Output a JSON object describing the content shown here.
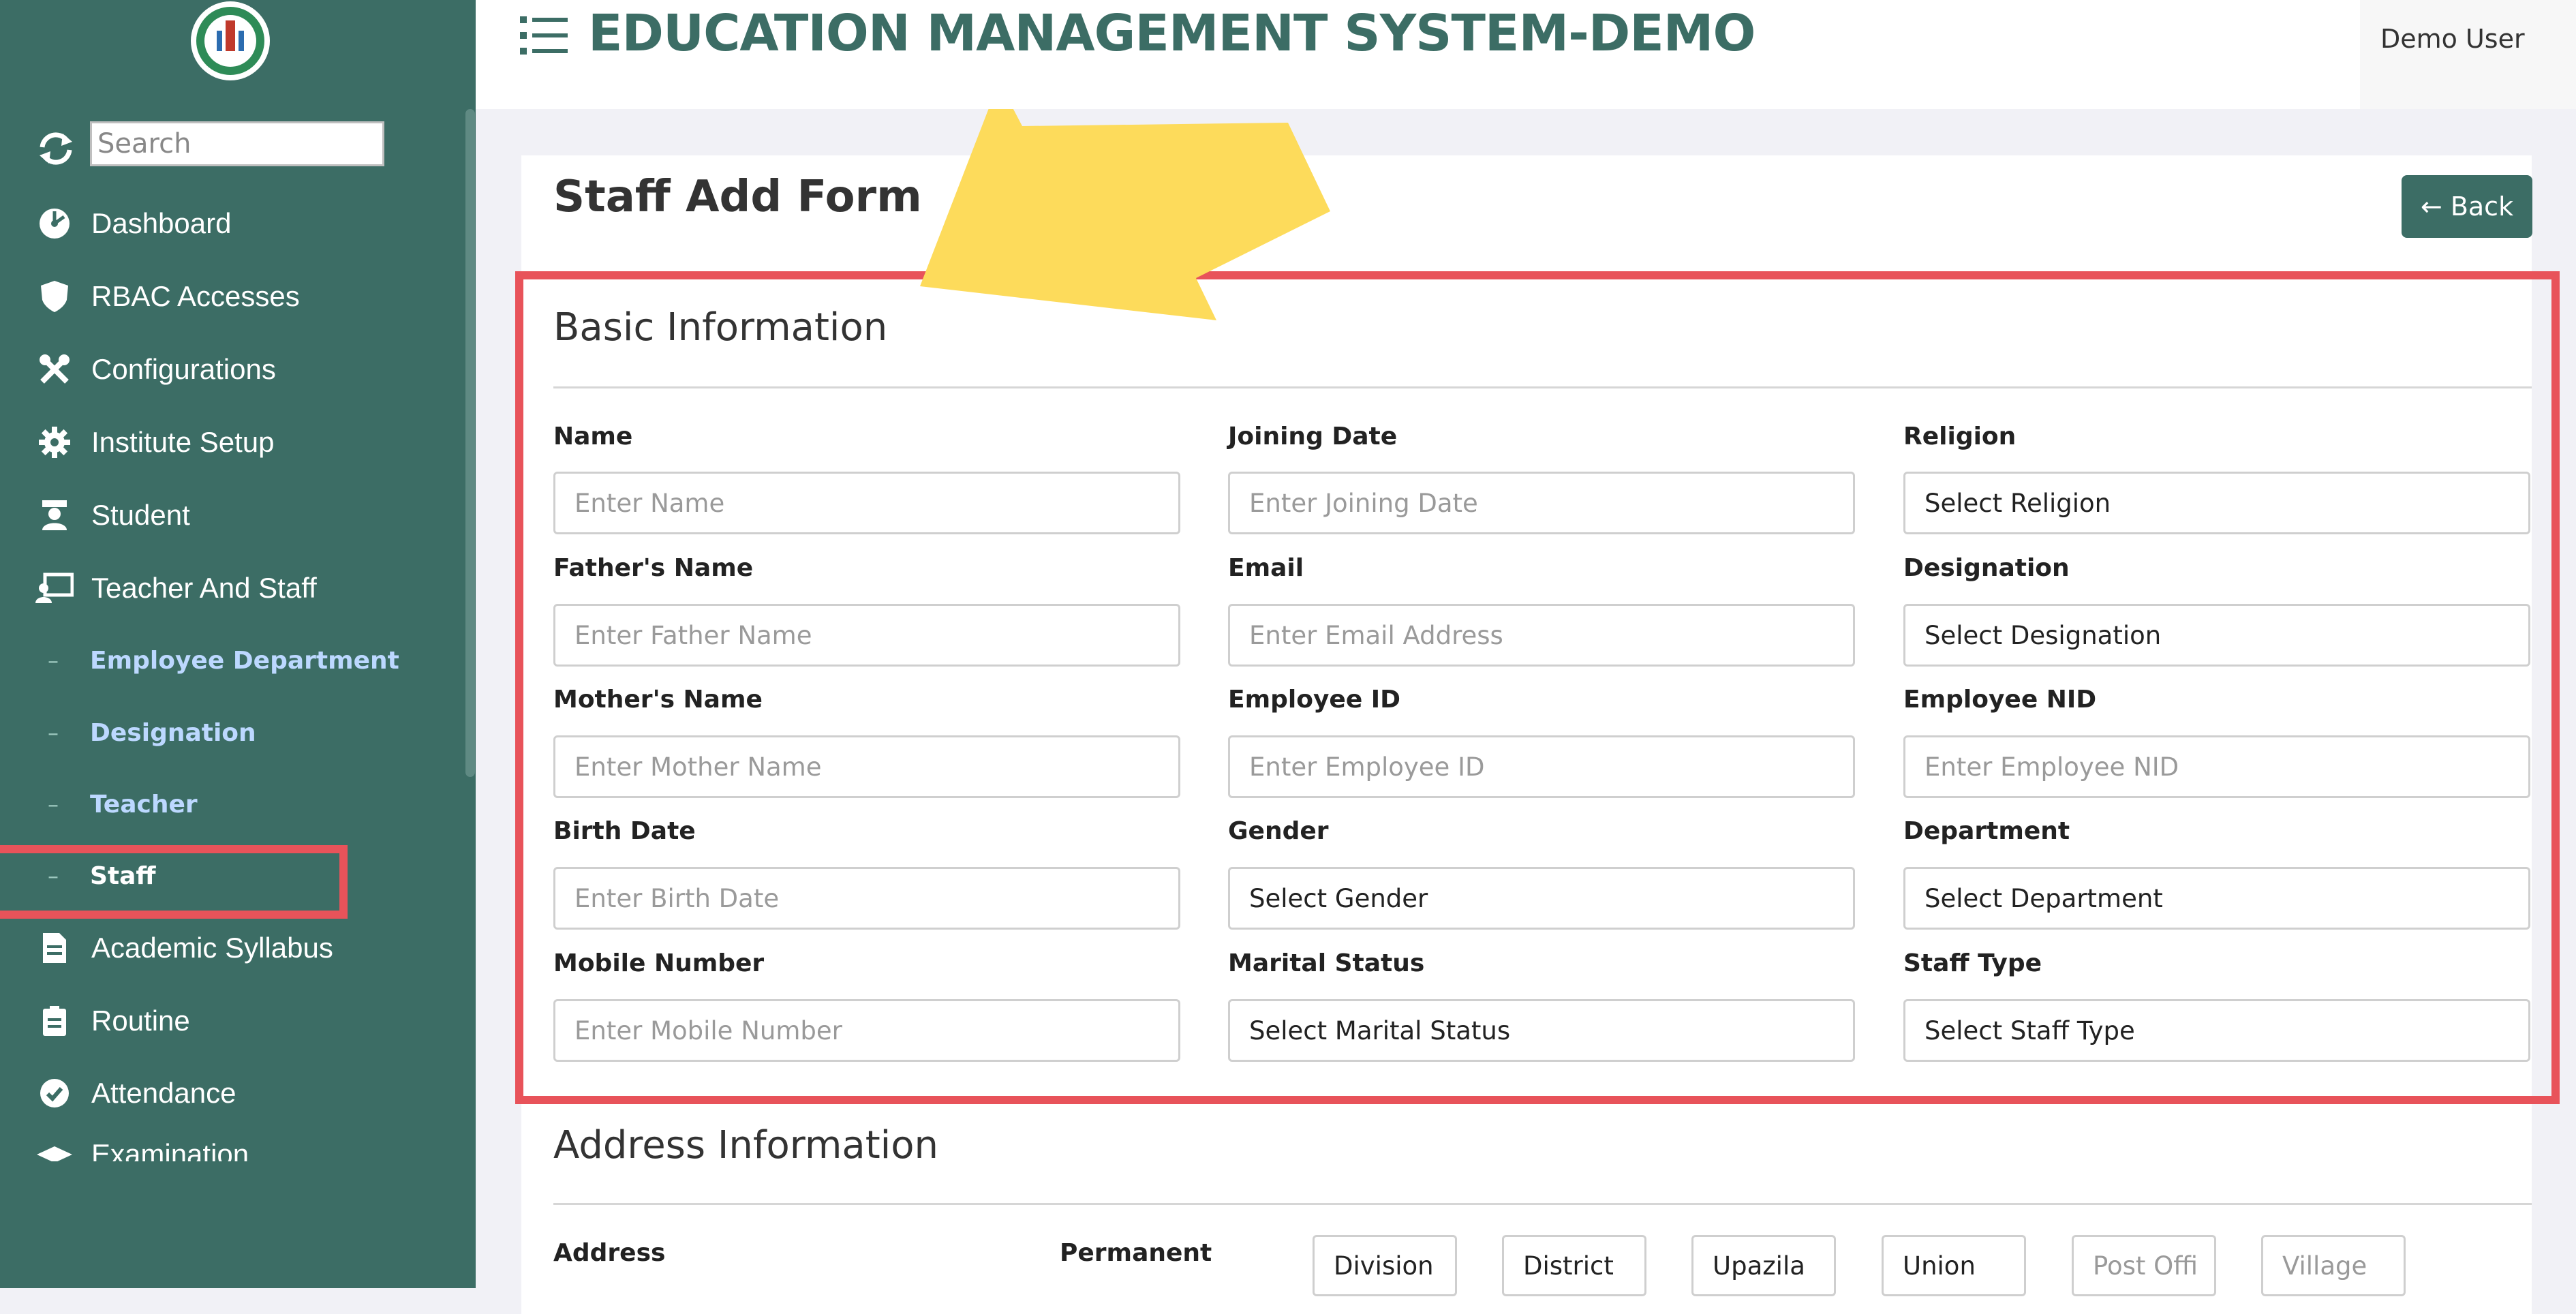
{
  "header": {
    "title": "EDUCATION MANAGEMENT SYSTEM-DEMO",
    "user": "Demo User"
  },
  "sidebar": {
    "search_placeholder": "Search",
    "items": [
      {
        "label": "Dashboard",
        "icon": "dashboard-icon"
      },
      {
        "label": "RBAC Accesses",
        "icon": "shield-icon"
      },
      {
        "label": "Configurations",
        "icon": "tools-icon"
      },
      {
        "label": "Institute Setup",
        "icon": "gear-icon"
      },
      {
        "label": "Student",
        "icon": "graduate-icon"
      },
      {
        "label": "Teacher And Staff",
        "icon": "teacher-icon"
      },
      {
        "label": "Academic Syllabus",
        "icon": "document-icon"
      },
      {
        "label": "Routine",
        "icon": "clipboard-icon"
      },
      {
        "label": "Attendance",
        "icon": "check-circle-icon"
      },
      {
        "label": "Examination",
        "icon": "graduation-cap-icon"
      }
    ],
    "sub_items": [
      "Employee Department",
      "Designation",
      "Teacher",
      "Staff"
    ],
    "active_sub_item": "Staff"
  },
  "form": {
    "title": "Staff Add Form",
    "back_label": "Back",
    "basic_section": "Basic Information",
    "fields": [
      {
        "label": "Name",
        "value": "Enter Name",
        "kind": "placeholder"
      },
      {
        "label": "Joining Date",
        "value": "Enter Joining Date",
        "kind": "placeholder"
      },
      {
        "label": "Religion",
        "value": "Select Religion",
        "kind": "select"
      },
      {
        "label": "Father's Name",
        "value": "Enter Father Name",
        "kind": "placeholder"
      },
      {
        "label": "Email",
        "value": "Enter Email Address",
        "kind": "placeholder"
      },
      {
        "label": "Designation",
        "value": "Select Designation",
        "kind": "select"
      },
      {
        "label": "Mother's Name",
        "value": "Enter Mother Name",
        "kind": "placeholder"
      },
      {
        "label": "Employee ID",
        "value": "Enter Employee ID",
        "kind": "placeholder"
      },
      {
        "label": "Employee NID",
        "value": "Enter Employee NID",
        "kind": "placeholder"
      },
      {
        "label": "Birth Date",
        "value": "Enter Birth Date",
        "kind": "placeholder"
      },
      {
        "label": "Gender",
        "value": "Select Gender",
        "kind": "select"
      },
      {
        "label": "Department",
        "value": "Select Department",
        "kind": "select"
      },
      {
        "label": "Mobile Number",
        "value": "Enter Mobile Number",
        "kind": "placeholder"
      },
      {
        "label": "Marital Status",
        "value": "Select Marital Status",
        "kind": "select"
      },
      {
        "label": "Staff Type",
        "value": "Select Staff Type",
        "kind": "select"
      }
    ],
    "address_section": "Address Information",
    "address_label": "Address",
    "permanent_label": "Permanent",
    "address_selects": [
      "Division",
      "District",
      "Upazila",
      "Union"
    ],
    "address_inputs": [
      "Post Offi",
      "Village"
    ]
  },
  "colors": {
    "sidebar": "#3c6d65",
    "accent": "#3c6d65",
    "highlight": "#e8535a",
    "arrow": "#fddb5b"
  }
}
